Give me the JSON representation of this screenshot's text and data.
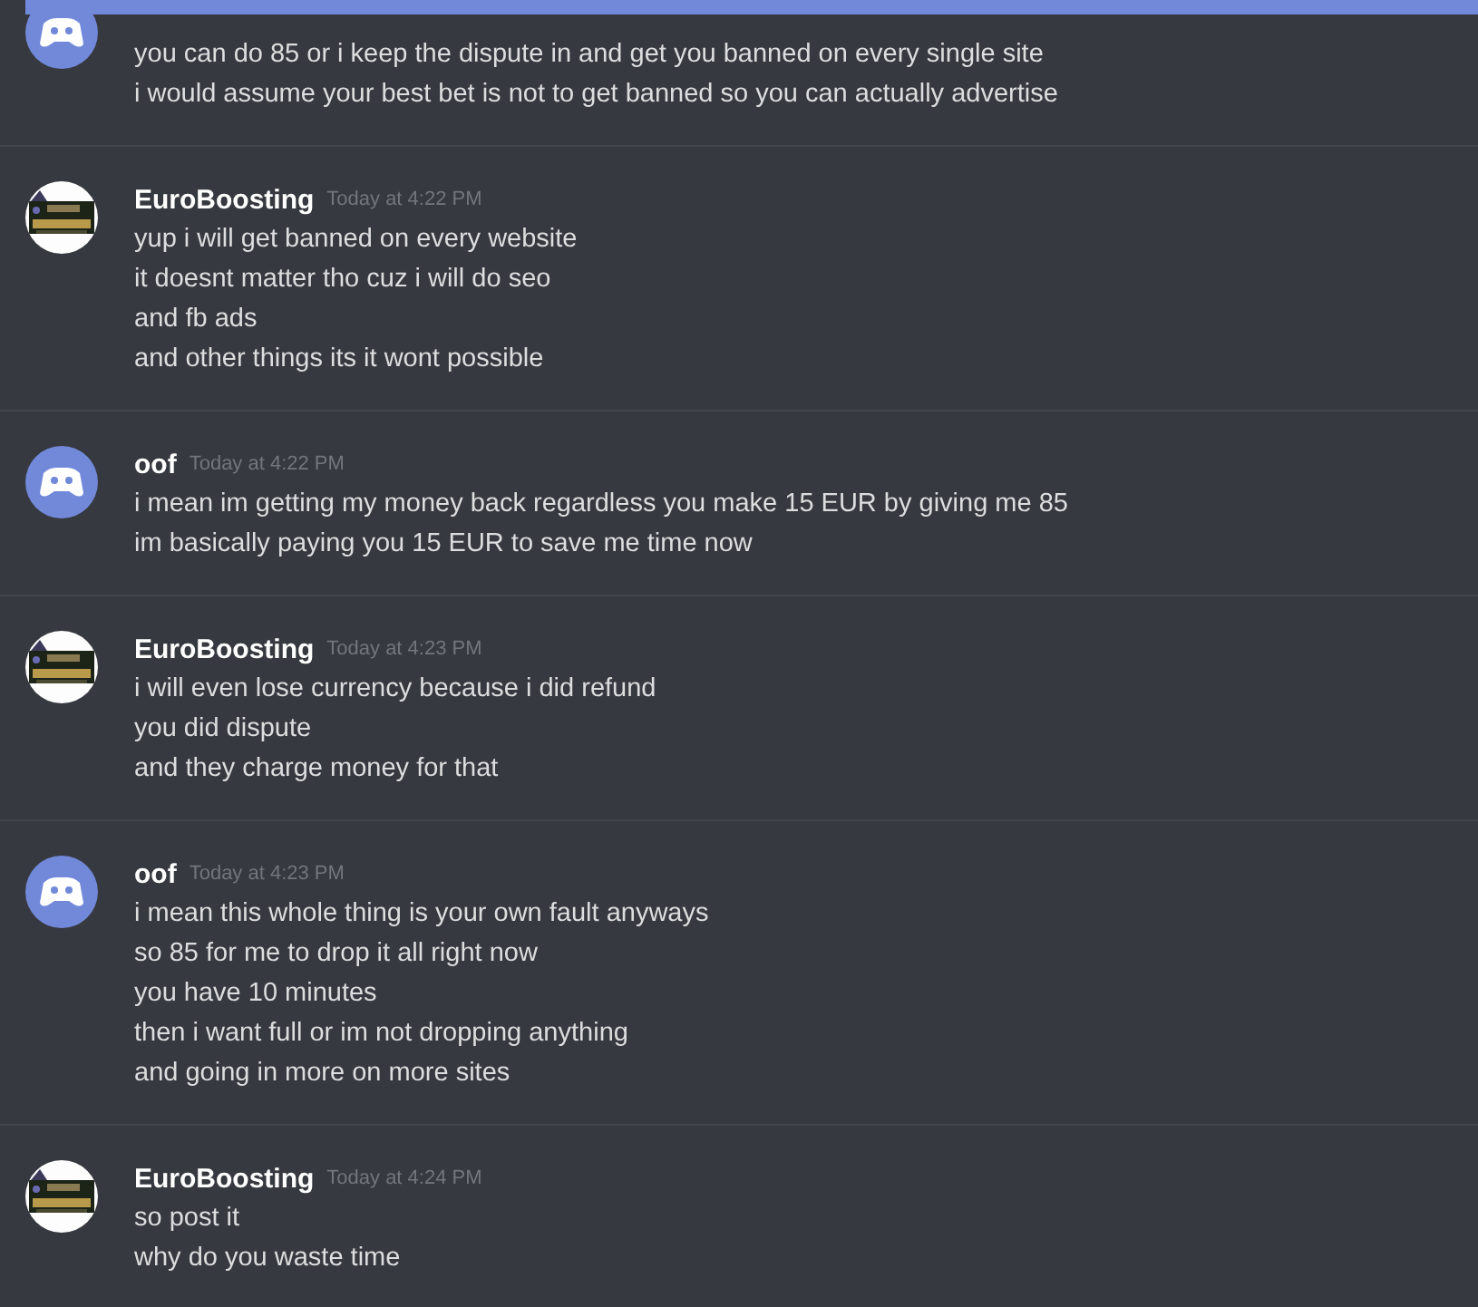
{
  "new_messages_bar": {
    "visible": true
  },
  "messages": [
    {
      "avatar": {
        "kind": "default"
      },
      "lines": [
        "you can do 85 or i keep the dispute in and get you banned on every single site",
        "i would assume your best bet is not to get banned so you can actually advertise"
      ]
    },
    {
      "author": "EuroBoosting",
      "avatar": {
        "kind": "picture"
      },
      "timestamp": "Today at 4:22 PM",
      "lines": [
        "yup i will get banned on every website",
        "it doesnt matter tho cuz i will do seo",
        "and fb ads",
        "and other things its it wont possible"
      ]
    },
    {
      "author": "oof",
      "avatar": {
        "kind": "default"
      },
      "timestamp": "Today at 4:22 PM",
      "lines": [
        "i mean im getting my money back regardless you make 15 EUR by giving me 85",
        "im basically paying you 15 EUR to save me time now"
      ]
    },
    {
      "author": "EuroBoosting",
      "avatar": {
        "kind": "picture"
      },
      "timestamp": "Today at 4:23 PM",
      "lines": [
        "i will even lose currency because i did refund",
        "you did dispute",
        "and they charge money for that"
      ]
    },
    {
      "author": "oof",
      "avatar": {
        "kind": "default"
      },
      "timestamp": "Today at 4:23 PM",
      "lines": [
        "i mean this whole thing is your own fault anyways",
        "so 85 for me to drop it all right now",
        "you have 10 minutes",
        "then i want full or im not dropping anything",
        "and going in more on more sites"
      ]
    },
    {
      "author": "EuroBoosting",
      "avatar": {
        "kind": "picture"
      },
      "timestamp": "Today at 4:24 PM",
      "lines": [
        "so post it",
        "why do you waste time"
      ]
    }
  ]
}
